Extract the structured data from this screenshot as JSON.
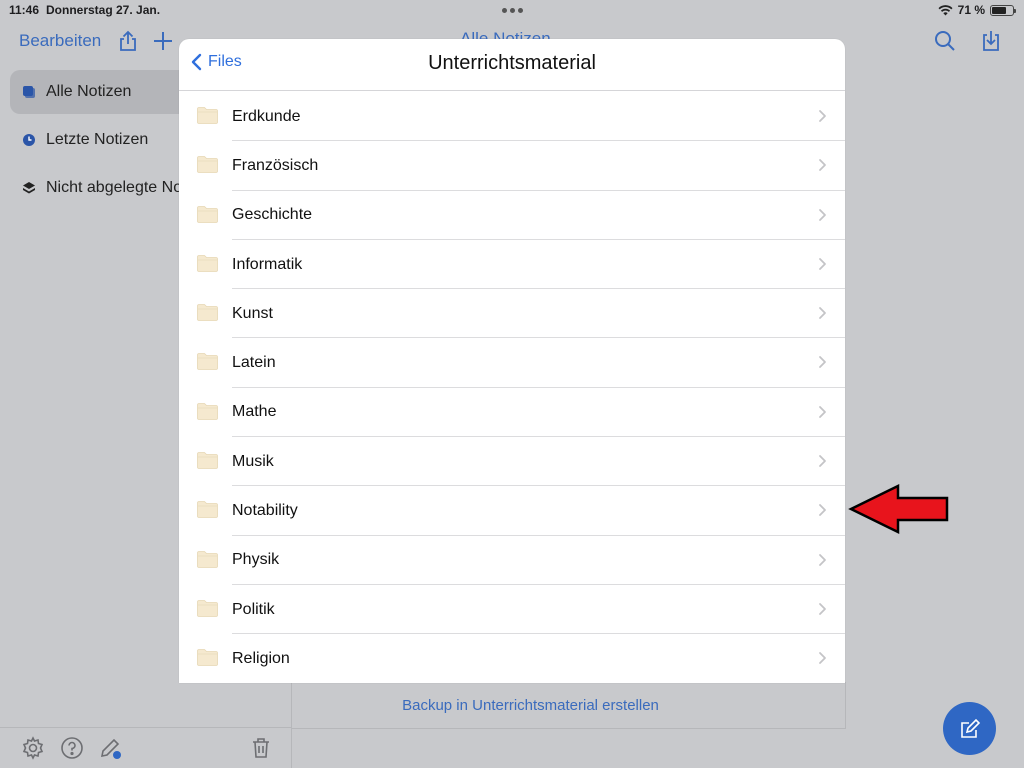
{
  "status_bar": {
    "time": "11:46",
    "date": "Donnerstag 27. Jan.",
    "battery_text": "71 %",
    "battery_level": 0.71
  },
  "toolbar": {
    "edit_label": "Bearbeiten",
    "title": "Alle Notizen"
  },
  "sidebar": {
    "items": [
      {
        "label": "Alle Notizen",
        "icon": "notes-stack-icon",
        "active": true
      },
      {
        "label": "Letzte Notizen",
        "icon": "clock-icon",
        "active": false
      },
      {
        "label": "Nicht abgelegte Notizen",
        "icon": "layers-icon",
        "active": false
      }
    ]
  },
  "backup": {
    "label": "Backup in Unterrichtsmaterial erstellen"
  },
  "modal": {
    "back_label": "Files",
    "title": "Unterrichtsmaterial",
    "folders": [
      "Erdkunde",
      "Französisch",
      "Geschichte",
      "Informatik",
      "Kunst",
      "Latein",
      "Mathe",
      "Musik",
      "Notability",
      "Physik",
      "Politik",
      "Religion"
    ]
  },
  "colors": {
    "accent": "#2f6fdd",
    "fab": "#2f67c4",
    "folder": "#f5e9cf",
    "annotation_arrow": "#e8141c"
  }
}
